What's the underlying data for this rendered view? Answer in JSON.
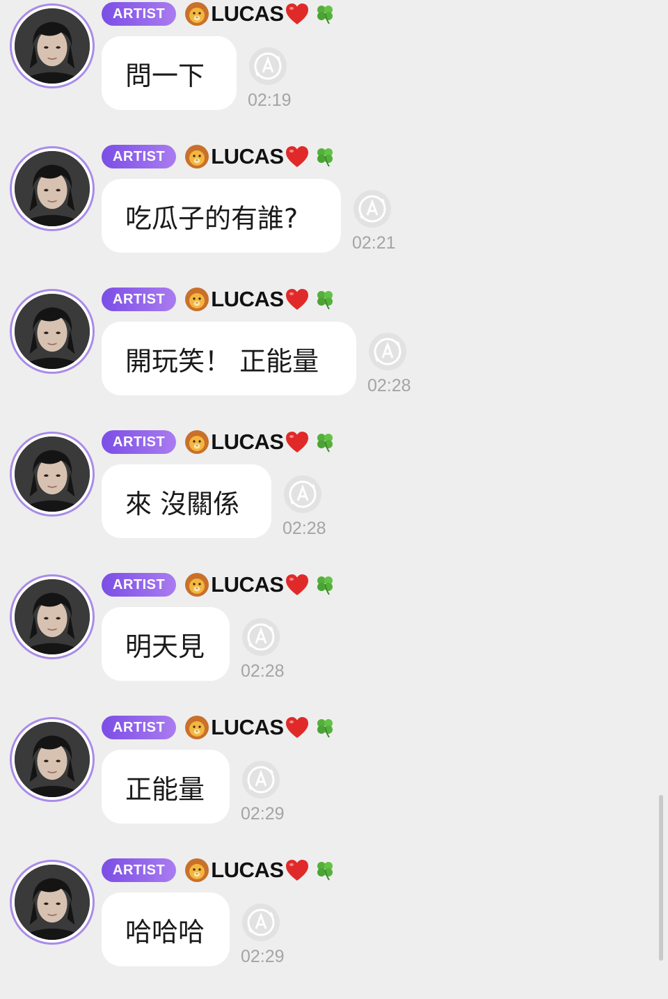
{
  "messages": [
    {
      "badge": "ARTIST",
      "sender": "LUCAS",
      "text": "問一下",
      "time": "02:19"
    },
    {
      "badge": "ARTIST",
      "sender": "LUCAS",
      "text": "吃瓜子的有誰?",
      "time": "02:21"
    },
    {
      "badge": "ARTIST",
      "sender": "LUCAS",
      "text": "開玩笑！ 正能量",
      "time": "02:28"
    },
    {
      "badge": "ARTIST",
      "sender": "LUCAS",
      "text": "來 沒關係",
      "time": "02:28"
    },
    {
      "badge": "ARTIST",
      "sender": "LUCAS",
      "text": "明天見",
      "time": "02:28"
    },
    {
      "badge": "ARTIST",
      "sender": "LUCAS",
      "text": "正能量",
      "time": "02:29"
    },
    {
      "badge": "ARTIST",
      "sender": "LUCAS",
      "text": "哈哈哈",
      "time": "02:29"
    }
  ],
  "icons": {
    "name_prefix": "lion-face-icon",
    "name_suffix": [
      "red-heart-icon",
      "four-leaf-clover-icon"
    ],
    "message_action": "auto-translate-icon"
  },
  "colors": {
    "background": "#eeeeee",
    "bubble": "#ffffff",
    "badge_gradient": [
      "#7b4ee6",
      "#a97cf0"
    ],
    "avatar_ring": "#a98be8",
    "time_text": "#a4a4a4"
  }
}
